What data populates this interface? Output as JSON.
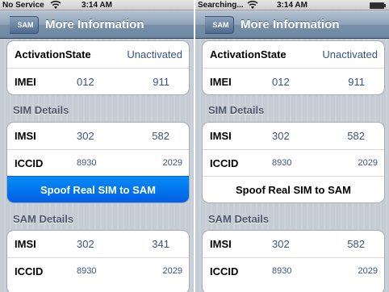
{
  "left": {
    "status": {
      "carrier": "No Service",
      "time": "3:14 AM"
    },
    "nav": {
      "back": "SAM",
      "title": "More Information"
    },
    "info": [
      {
        "key": "ActivationState",
        "value": "Unactivated"
      },
      {
        "key": "IMEI",
        "v1": "012",
        "v2": "911"
      }
    ],
    "sim_header": "SIM Details",
    "sim": [
      {
        "key": "IMSI",
        "v1": "302",
        "v2": "582"
      },
      {
        "key": "ICCID",
        "v1": "8930",
        "v2": "2029"
      }
    ],
    "spoof_label": "Spoof Real SIM to SAM",
    "sam_header": "SAM Details",
    "sam": [
      {
        "key": "IMSI",
        "v1": "302",
        "v2": "341"
      },
      {
        "key": "ICCID",
        "v1": "8930",
        "v2": "2029"
      }
    ]
  },
  "right": {
    "status": {
      "carrier": "Searching...",
      "time": "3:14 AM"
    },
    "nav": {
      "back": "SAM",
      "title": "More Information"
    },
    "info": [
      {
        "key": "ActivationState",
        "value": "Unactivated"
      },
      {
        "key": "IMEI",
        "v1": "012",
        "v2": "911"
      }
    ],
    "sim_header": "SIM Details",
    "sim": [
      {
        "key": "IMSI",
        "v1": "302",
        "v2": "582"
      },
      {
        "key": "ICCID",
        "v1": "8930",
        "v2": "2029"
      }
    ],
    "spoof_label": "Spoof Real SIM to SAM",
    "sam_header": "SAM Details",
    "sam": [
      {
        "key": "IMSI",
        "v1": "302",
        "v2": "582"
      },
      {
        "key": "ICCID",
        "v1": "8930",
        "v2": "2029"
      }
    ]
  },
  "colors": {
    "accent_selected": "#0a74f0",
    "nav_bar": "#6d87a3",
    "value_text": "#385487"
  }
}
